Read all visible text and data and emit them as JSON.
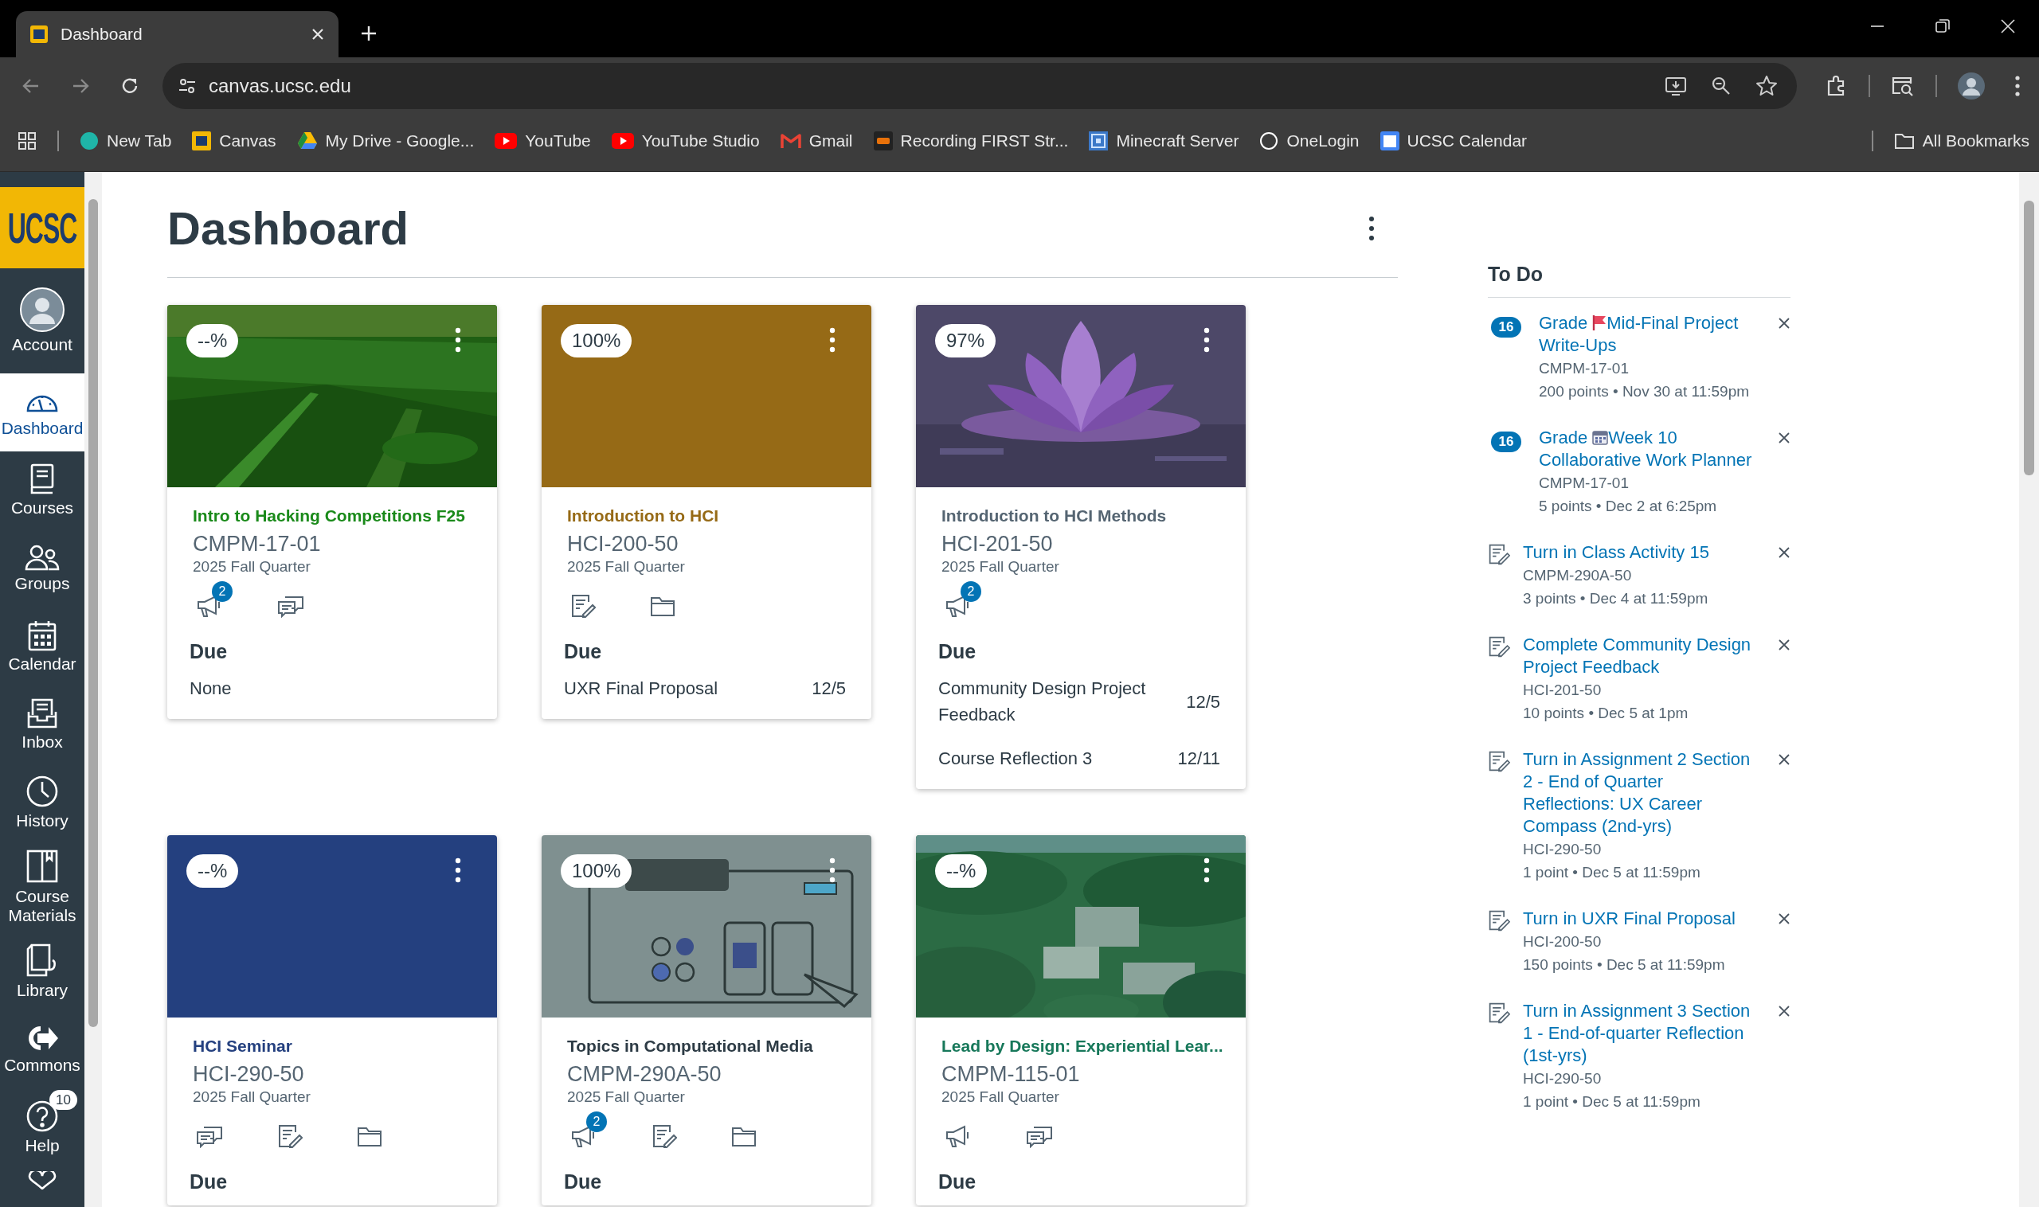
{
  "browser": {
    "tab_title": "Dashboard",
    "url": "canvas.ucsc.edu",
    "bookmarks": [
      {
        "label": "New Tab",
        "kind": "circle"
      },
      {
        "label": "Canvas",
        "kind": "logo"
      },
      {
        "label": "My Drive - Google...",
        "kind": "triangle"
      },
      {
        "label": "YouTube",
        "kind": "play"
      },
      {
        "label": "YouTube Studio",
        "kind": "play"
      },
      {
        "label": "Gmail",
        "kind": "mail"
      },
      {
        "label": "Recording FIRST Str...",
        "kind": "square"
      },
      {
        "label": "Minecraft Server",
        "kind": "grid"
      },
      {
        "label": "OneLogin",
        "kind": "ring"
      },
      {
        "label": "UCSC Calendar",
        "kind": "calendar"
      }
    ],
    "all_bookmarks": "All Bookmarks"
  },
  "sidebar": {
    "logo": "UCSC",
    "items": [
      {
        "label": "Account",
        "kind": "account",
        "selected": false
      },
      {
        "label": "Dashboard",
        "kind": "dashboard",
        "selected": true
      },
      {
        "label": "Courses",
        "kind": "courses",
        "selected": false
      },
      {
        "label": "Groups",
        "kind": "groups",
        "selected": false
      },
      {
        "label": "Calendar",
        "kind": "calendar",
        "selected": false
      },
      {
        "label": "Inbox",
        "kind": "inbox",
        "selected": false
      },
      {
        "label": "History",
        "kind": "history",
        "selected": false
      },
      {
        "label": "Course Materials",
        "kind": "materials",
        "selected": false
      },
      {
        "label": "Library",
        "kind": "library",
        "selected": false
      },
      {
        "label": "Commons",
        "kind": "commons",
        "selected": false
      },
      {
        "label": "Help",
        "kind": "help",
        "selected": false,
        "badge": "10"
      }
    ]
  },
  "page": {
    "title": "Dashboard"
  },
  "cards": [
    {
      "kind": "picture",
      "grade": "--%",
      "title": "Intro to Hacking Competitions F25",
      "code": "CMPM-17-01",
      "term": "2025 Fall Quarter",
      "color": "#1a8a1a",
      "icons": [
        {
          "kind": "announcement",
          "badge": "2"
        },
        {
          "kind": "discussion"
        }
      ],
      "due_heading": "Due",
      "due": [
        {
          "name": "None"
        }
      ]
    },
    {
      "kind": "solid",
      "grade": "100%",
      "title": "Introduction to HCI",
      "code": "HCI-200-50",
      "term": "2025 Fall Quarter",
      "color": "#966a16",
      "icons": [
        {
          "kind": "assignment"
        },
        {
          "kind": "folder"
        }
      ],
      "due_heading": "Due",
      "due": [
        {
          "name": "UXR Final Proposal",
          "date": "12/5"
        }
      ]
    },
    {
      "kind": "picture",
      "grade": "97%",
      "title": "Introduction to HCI Methods",
      "code": "HCI-201-50",
      "term": "2025 Fall Quarter",
      "color": "#556572",
      "icons": [
        {
          "kind": "announcement",
          "badge": "2"
        }
      ],
      "due_heading": "Due",
      "due": [
        {
          "name": "Community Design Project Feedback",
          "date": "12/5"
        },
        {
          "name": "Course Reflection 3",
          "date": "12/11"
        }
      ]
    },
    {
      "kind": "solid",
      "grade": "--%",
      "title": "HCI Seminar",
      "code": "HCI-290-50",
      "term": "2025 Fall Quarter",
      "color": "#24407f",
      "icons": [
        {
          "kind": "discussion"
        },
        {
          "kind": "assignment"
        },
        {
          "kind": "folder"
        }
      ],
      "due_heading": "Due"
    },
    {
      "kind": "picture",
      "grade": "100%",
      "title": "Topics in Computational Media",
      "code": "CMPM-290A-50",
      "term": "2025 Fall Quarter",
      "color": "#2d3b45",
      "icons": [
        {
          "kind": "announcement",
          "badge": "2"
        },
        {
          "kind": "assignment"
        },
        {
          "kind": "folder"
        }
      ],
      "due_heading": "Due"
    },
    {
      "kind": "picture",
      "grade": "--%",
      "title": "Lead by Design: Experiential Lear...",
      "code": "CMPM-115-01",
      "term": "2025 Fall Quarter",
      "color": "#17785a",
      "icons": [
        {
          "kind": "announcement"
        },
        {
          "kind": "discussion"
        }
      ],
      "due_heading": "Due"
    }
  ],
  "todo": {
    "title": "To Do",
    "items": [
      {
        "kind": "flagged",
        "badge": "16",
        "title_lead": "Grade",
        "title": "Mid-Final Project Write-Ups",
        "course": "CMPM-17-01",
        "details": "200 points • Nov 30 at 11:59pm"
      },
      {
        "kind": "planned",
        "badge": "16",
        "title_lead": "Grade",
        "title": "Week 10 Collaborative Work Planner",
        "course": "CMPM-17-01",
        "details": "5 points • Dec 2 at 6:25pm"
      },
      {
        "kind": "assignment",
        "title": "Turn in Class Activity 15",
        "course": "CMPM-290A-50",
        "details": "3 points • Dec 4 at 11:59pm"
      },
      {
        "kind": "assignment",
        "title": "Complete Community Design Project Feedback",
        "course": "HCI-201-50",
        "details": "10 points • Dec 5 at 1pm"
      },
      {
        "kind": "assignment",
        "title": "Turn in Assignment 2 Section 2 - End of Quarter Reflections: UX Career Compass (2nd-yrs)",
        "course": "HCI-290-50",
        "details": "1 point • Dec 5 at 11:59pm"
      },
      {
        "kind": "assignment",
        "title": "Turn in UXR Final Proposal",
        "course": "HCI-200-50",
        "details": "150 points • Dec 5 at 11:59pm"
      },
      {
        "kind": "assignment",
        "title": "Turn in Assignment 3 Section 1 - End-of-quarter Reflection (1st-yrs)",
        "course": "HCI-290-50",
        "details": "1 point • Dec 5 at 11:59pm"
      }
    ]
  }
}
